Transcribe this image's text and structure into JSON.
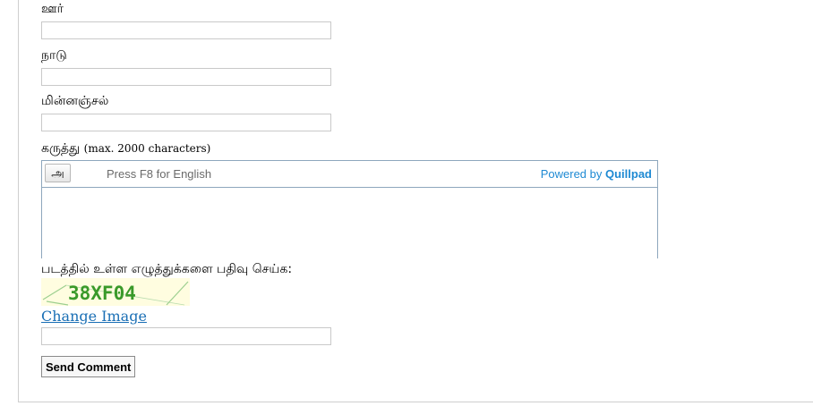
{
  "form": {
    "city_label": "ஊர்",
    "city_value": "",
    "country_label": "நாடு",
    "country_value": "",
    "email_label": "மின்னஞ்சல்",
    "email_value": "",
    "comment_label": "கருத்து",
    "comment_hint": "(max. 2000 characters)",
    "captcha_label": "படத்தில் உள்ள எழுத்துக்களை பதிவு செய்க:",
    "captcha_value": "",
    "change_image_label": "Change Image",
    "send_label": "Send Comment"
  },
  "editor": {
    "lang_button": "அ",
    "press_hint": "Press F8 for English",
    "powered_prefix": "Powered by",
    "powered_brand": "Quillpad",
    "content": ""
  },
  "captcha": {
    "text": "38XF04"
  },
  "colors": {
    "link": "#1a6fb5",
    "quillpad_blue": "#1f8ad3",
    "captcha_bg": "#fffde0",
    "captcha_text": "#3a9a2a"
  }
}
